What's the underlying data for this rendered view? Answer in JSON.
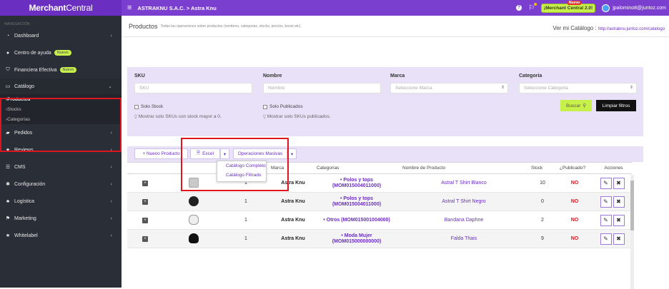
{
  "topbar": {
    "brand_bold": "Merchant",
    "brand_light": "Central",
    "breadcrumb": "ASTRAKNU S.A.C. > Astra Knu",
    "mc_badge": "¡Merchant Central 2.0!",
    "mc_badge_new": "Nuevo",
    "user_email": "jpalomino8@juntoz.com"
  },
  "sidebar": {
    "heading": "NAVEGACIÓN",
    "items": [
      {
        "label": "Dashboard",
        "icon": "dashboard-icon"
      },
      {
        "label": "Centro de ayuda",
        "icon": "help-icon",
        "pill": "Nuevo"
      },
      {
        "label": "Financiera Efectiva",
        "icon": "finance-icon",
        "pill": "Nuevo"
      },
      {
        "label": "Catálogo",
        "icon": "monitor-icon"
      },
      {
        "label": "Pedidos",
        "icon": "truck-icon"
      },
      {
        "label": "Reviews",
        "icon": "star-icon"
      },
      {
        "label": "CMS",
        "icon": "list-icon"
      },
      {
        "label": "Configuración",
        "icon": "gear-icon"
      },
      {
        "label": "Logística",
        "icon": "logistics-icon"
      },
      {
        "label": "Marketing",
        "icon": "flag-icon"
      },
      {
        "label": "Whitelabel",
        "icon": "star-icon"
      }
    ],
    "sub_items": [
      "Productos",
      "Stocks",
      "Categorías"
    ]
  },
  "page": {
    "title": "Productos",
    "subtitle": "Todas las operaciones sobre productos (nombres, categorias, stocks, precios, boost etc).",
    "catalog_label": "Ver mi Catálogo :",
    "catalog_url": "http://astraknu.juntoz.com/catalogo"
  },
  "filters": {
    "sku_label": "SKU",
    "sku_placeholder": "SKU",
    "nombre_label": "Nombre",
    "nombre_placeholder": "Nombre",
    "marca_label": "Marca",
    "marca_placeholder": "Seleccione Marca",
    "categoria_label": "Categoria",
    "categoria_placeholder": "Seleccione Categoria",
    "solo_stock": "Solo Stock",
    "solo_stock_hint": "Mostrar solo SKUs con stock mayor a 0.",
    "solo_publicados": "Solo Publicados",
    "solo_publicados_hint": "Mostrar solo SKUs publicados.",
    "buscar": "Buscar",
    "limpiar": "Limpiar filtros"
  },
  "toolbar": {
    "nuevo": "+ Nuevo Producto",
    "excel": "Excel",
    "masivas": "Operaciones Masivas",
    "dropdown": [
      "Catálogo Completo",
      "Catálogo Filtrado"
    ]
  },
  "table": {
    "headers": [
      "",
      "",
      "",
      "Marca",
      "Categorias",
      "Nombre de Producto",
      "Stock",
      "¿Publicado?",
      "Acciones"
    ],
    "rows": [
      {
        "qty": "1",
        "marca": "Astra Knu",
        "cat1": "Polos y tops",
        "cat2": "(MOM015004011000)",
        "nombre": "Astral T Shirt Blanco",
        "stock": "10",
        "pub": "NO"
      },
      {
        "qty": "1",
        "marca": "Astra Knu",
        "cat1": "Polos y tops",
        "cat2": "(MOM015004011000)",
        "nombre": "Astral T Shirt Negro",
        "stock": "0",
        "pub": "NO"
      },
      {
        "qty": "1",
        "marca": "Astra Knu",
        "cat1": "Otros (MOM015001004000)",
        "cat2": "",
        "nombre": "Bandana Daphne",
        "stock": "2",
        "pub": "NO"
      },
      {
        "qty": "1",
        "marca": "Astra Knu",
        "cat1": "Moda Mujer",
        "cat2": "(MOM015000000000)",
        "nombre": "Falda Thais",
        "stock": "9",
        "pub": "NO"
      }
    ]
  },
  "colors": {
    "brand": "#7b3fd0",
    "sidebar": "#2a2e36",
    "accent": "#c8f04a",
    "highlight": "#e0141e"
  }
}
